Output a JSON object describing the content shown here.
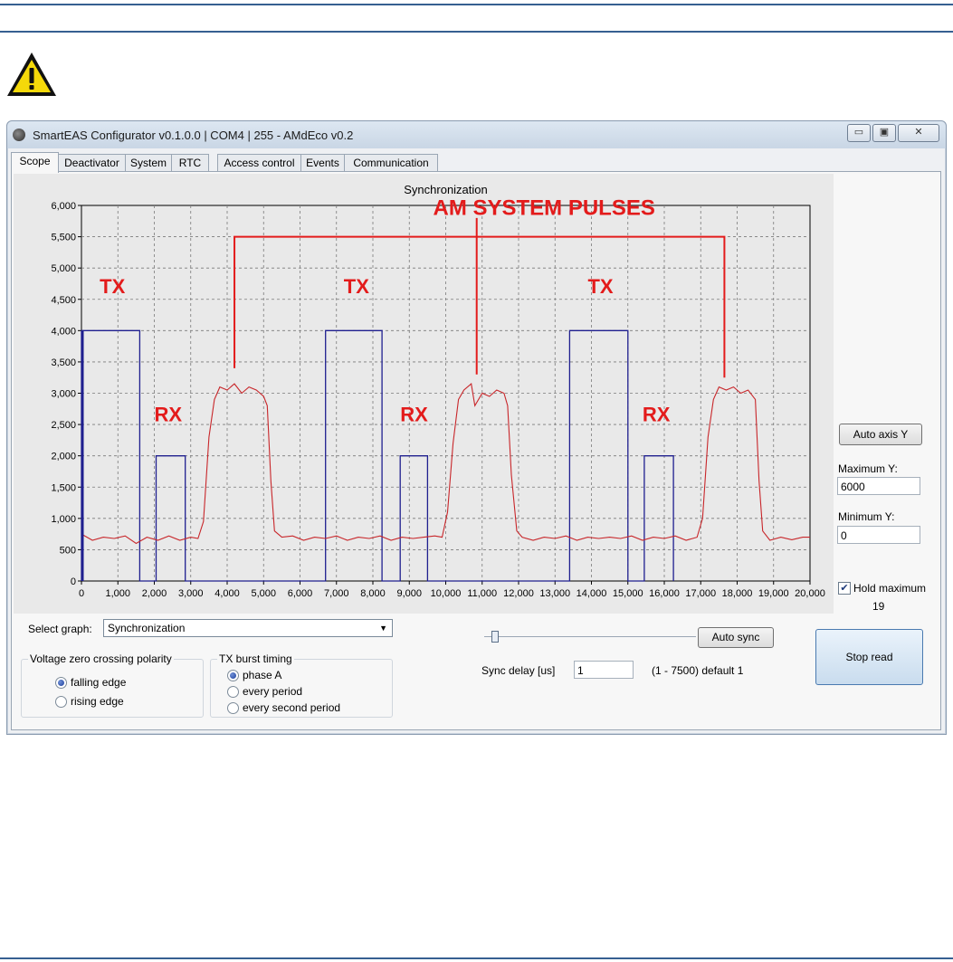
{
  "window": {
    "title": "SmartEAS Configurator v0.1.0.0 | COM4 | 255 - AMdEco v0.2",
    "controls": {
      "minimize": "▭",
      "maximize": "▣",
      "close": "✕"
    }
  },
  "tabs": [
    {
      "label": "Scope",
      "active": true
    },
    {
      "label": "Deactivator",
      "active": false
    },
    {
      "label": "System",
      "active": false
    },
    {
      "label": "RTC",
      "active": false
    },
    {
      "label": "Access control",
      "active": false
    },
    {
      "label": "Events",
      "active": false
    },
    {
      "label": "Communication",
      "active": false
    }
  ],
  "chart_data": {
    "type": "line",
    "title": "Synchronization",
    "xlabel": "",
    "ylabel": "",
    "xlim": [
      0,
      20000
    ],
    "ylim": [
      0,
      6000
    ],
    "x_ticks": [
      "0",
      "1,000",
      "2,000",
      "3,000",
      "4,000",
      "5,000",
      "6,000",
      "7,000",
      "8,000",
      "9,000",
      "10,000",
      "11,000",
      "12,000",
      "13,000",
      "14,000",
      "15,000",
      "16,000",
      "17,000",
      "18,000",
      "19,000",
      "20,000"
    ],
    "y_ticks": [
      "0",
      "500",
      "1,000",
      "1,500",
      "2,000",
      "2,500",
      "3,000",
      "3,500",
      "4,000",
      "4,500",
      "5,000",
      "5,500",
      "6,000"
    ],
    "grid": true,
    "series": [
      {
        "color": "#1f1f8f",
        "style": "step",
        "points": [
          [
            0,
            0
          ],
          [
            0,
            4000
          ],
          [
            1600,
            4000
          ],
          [
            1600,
            0
          ],
          [
            2050,
            0
          ],
          [
            2050,
            2000
          ],
          [
            2850,
            2000
          ],
          [
            2850,
            0
          ],
          [
            6700,
            0
          ],
          [
            6700,
            4000
          ],
          [
            8250,
            4000
          ],
          [
            8250,
            0
          ],
          [
            8750,
            0
          ],
          [
            8750,
            2000
          ],
          [
            9500,
            2000
          ],
          [
            9500,
            0
          ],
          [
            13400,
            0
          ],
          [
            13400,
            4000
          ],
          [
            15000,
            4000
          ],
          [
            15000,
            0
          ],
          [
            15450,
            0
          ],
          [
            15450,
            2000
          ],
          [
            16250,
            2000
          ],
          [
            16250,
            0
          ]
        ]
      },
      {
        "color": "#c8262a",
        "style": "line",
        "points": [
          [
            0,
            750
          ],
          [
            300,
            650
          ],
          [
            600,
            700
          ],
          [
            900,
            680
          ],
          [
            1200,
            720
          ],
          [
            1500,
            600
          ],
          [
            1800,
            700
          ],
          [
            2100,
            650
          ],
          [
            2400,
            720
          ],
          [
            2700,
            650
          ],
          [
            3000,
            700
          ],
          [
            3200,
            680
          ],
          [
            3350,
            950
          ],
          [
            3500,
            2300
          ],
          [
            3650,
            2900
          ],
          [
            3800,
            3100
          ],
          [
            4000,
            3050
          ],
          [
            4200,
            3150
          ],
          [
            4400,
            3000
          ],
          [
            4600,
            3100
          ],
          [
            4800,
            3050
          ],
          [
            5000,
            2950
          ],
          [
            5100,
            2800
          ],
          [
            5200,
            1600
          ],
          [
            5300,
            800
          ],
          [
            5500,
            700
          ],
          [
            5800,
            720
          ],
          [
            6100,
            650
          ],
          [
            6400,
            700
          ],
          [
            6700,
            680
          ],
          [
            7000,
            720
          ],
          [
            7300,
            650
          ],
          [
            7600,
            700
          ],
          [
            7900,
            680
          ],
          [
            8200,
            720
          ],
          [
            8500,
            650
          ],
          [
            8800,
            700
          ],
          [
            9100,
            680
          ],
          [
            9400,
            700
          ],
          [
            9700,
            720
          ],
          [
            9900,
            700
          ],
          [
            10050,
            1100
          ],
          [
            10200,
            2200
          ],
          [
            10350,
            2900
          ],
          [
            10500,
            3050
          ],
          [
            10700,
            3150
          ],
          [
            10800,
            2800
          ],
          [
            11000,
            3000
          ],
          [
            11200,
            2950
          ],
          [
            11400,
            3050
          ],
          [
            11600,
            3000
          ],
          [
            11700,
            2800
          ],
          [
            11800,
            1700
          ],
          [
            11950,
            800
          ],
          [
            12100,
            700
          ],
          [
            12400,
            650
          ],
          [
            12700,
            700
          ],
          [
            13000,
            680
          ],
          [
            13300,
            720
          ],
          [
            13600,
            650
          ],
          [
            13900,
            700
          ],
          [
            14200,
            680
          ],
          [
            14500,
            700
          ],
          [
            14800,
            680
          ],
          [
            15100,
            720
          ],
          [
            15400,
            650
          ],
          [
            15700,
            700
          ],
          [
            16000,
            680
          ],
          [
            16300,
            720
          ],
          [
            16600,
            650
          ],
          [
            16900,
            700
          ],
          [
            17050,
            1000
          ],
          [
            17200,
            2300
          ],
          [
            17350,
            2900
          ],
          [
            17500,
            3100
          ],
          [
            17700,
            3050
          ],
          [
            17900,
            3100
          ],
          [
            18100,
            3000
          ],
          [
            18300,
            3050
          ],
          [
            18500,
            2900
          ],
          [
            18600,
            1600
          ],
          [
            18700,
            800
          ],
          [
            18900,
            650
          ],
          [
            19200,
            700
          ],
          [
            19500,
            660
          ],
          [
            19800,
            700
          ],
          [
            20000,
            700
          ]
        ]
      }
    ],
    "annotations": [
      {
        "text": "AM SYSTEM PULSES"
      },
      {
        "text": "TX"
      },
      {
        "text": "TX"
      },
      {
        "text": "TX"
      },
      {
        "text": "RX"
      },
      {
        "text": "RX"
      },
      {
        "text": "RX"
      }
    ]
  },
  "right_panel": {
    "auto_axis_label": "Auto axis Y",
    "max_label": "Maximum Y:",
    "max_value": "6000",
    "min_label": "Minimum Y:",
    "min_value": "0",
    "hold_label": "Hold maximum",
    "hold_checked": true,
    "hold_value": "19",
    "stop_label": "Stop read"
  },
  "bottom": {
    "select_label": "Select graph:",
    "select_value": "Synchronization",
    "voltage_group": {
      "title": "Voltage zero crossing polarity",
      "options": [
        "falling edge",
        "rising edge"
      ],
      "selected": 0
    },
    "tx_group": {
      "title": "TX burst timing",
      "options": [
        "phase A",
        "every period",
        "every second period"
      ],
      "selected": 0
    },
    "auto_sync_label": "Auto sync",
    "sync_delay_label": "Sync delay [us]",
    "sync_delay_value": "1",
    "sync_delay_hint": "(1 - 7500) default 1"
  }
}
